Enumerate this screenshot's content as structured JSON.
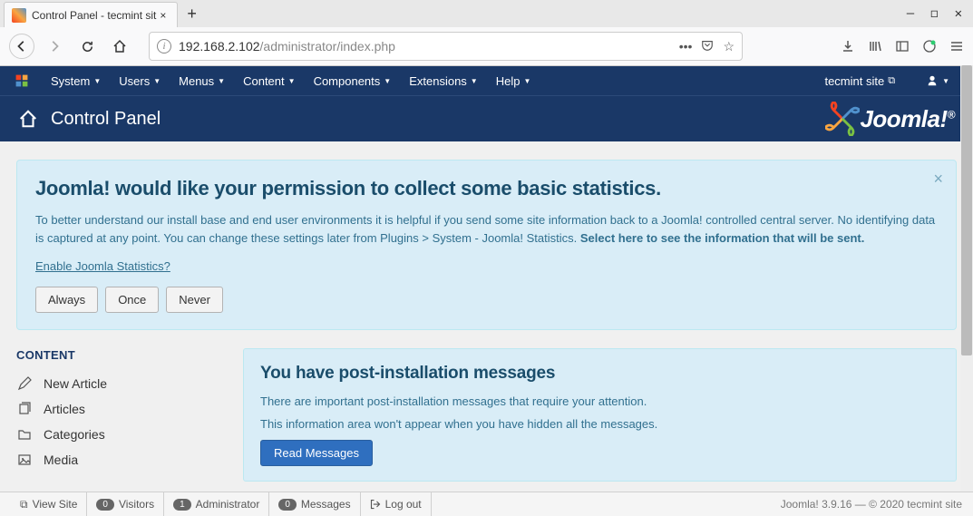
{
  "browser": {
    "tab_title": "Control Panel - tecmint sit",
    "url_host": "192.168.2.102",
    "url_path": "/administrator/index.php"
  },
  "menu": {
    "items": [
      "System",
      "Users",
      "Menus",
      "Content",
      "Components",
      "Extensions",
      "Help"
    ],
    "site_name": "tecmint site"
  },
  "page_title": "Control Panel",
  "brand": "Joomla!",
  "alert": {
    "title": "Joomla! would like your permission to collect some basic statistics.",
    "body_a": "To better understand our install base and end user environments it is helpful if you send some site information back to a Joomla! controlled central server. No identifying data is captured at any point. You can change these settings later from Plugins > System - Joomla! Statistics. ",
    "body_b": "Select here to see the information that will be sent.",
    "enable_link": "Enable Joomla Statistics?",
    "btn_always": "Always",
    "btn_once": "Once",
    "btn_never": "Never"
  },
  "sidebar": {
    "heading": "CONTENT",
    "items": [
      {
        "label": "New Article",
        "icon": "pencil"
      },
      {
        "label": "Articles",
        "icon": "stack"
      },
      {
        "label": "Categories",
        "icon": "folder"
      },
      {
        "label": "Media",
        "icon": "image"
      }
    ]
  },
  "post_install": {
    "title": "You have post-installation messages",
    "line1": "There are important post-installation messages that require your attention.",
    "line2": "This information area won't appear when you have hidden all the messages.",
    "button": "Read Messages"
  },
  "status": {
    "view_site": "View Site",
    "visitors_count": "0",
    "visitors_label": "Visitors",
    "admin_count": "1",
    "admin_label": "Administrator",
    "messages_count": "0",
    "messages_label": "Messages",
    "logout": "Log out",
    "footer": "Joomla! 3.9.16  —  © 2020 tecmint site"
  }
}
